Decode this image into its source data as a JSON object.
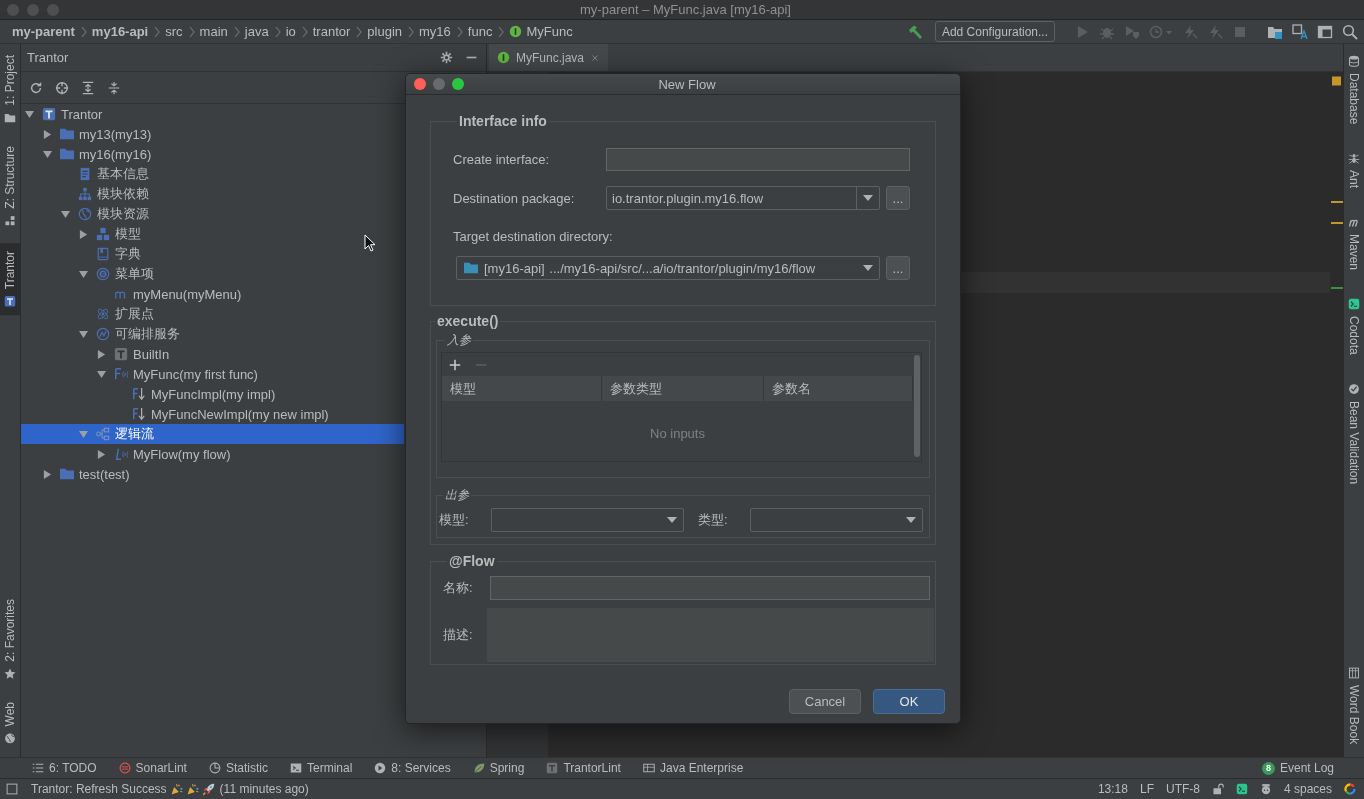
{
  "window": {
    "title": "my-parent – MyFunc.java [my16-api]"
  },
  "breadcrumbs": [
    {
      "label": "my-parent",
      "kind": "module"
    },
    {
      "label": "my16-api",
      "kind": "module"
    },
    {
      "label": "src",
      "kind": "folder"
    },
    {
      "label": "main",
      "kind": "folder"
    },
    {
      "label": "java",
      "kind": "folder"
    },
    {
      "label": "io",
      "kind": "folder"
    },
    {
      "label": "trantor",
      "kind": "folder"
    },
    {
      "label": "plugin",
      "kind": "folder"
    },
    {
      "label": "my16",
      "kind": "folder"
    },
    {
      "label": "func",
      "kind": "folder"
    },
    {
      "label": "MyFunc",
      "kind": "interface"
    }
  ],
  "toolbar": [
    {
      "kind": "build",
      "disabled": false
    },
    {
      "kind": "configuration",
      "label": "Add Configuration..."
    },
    {
      "kind": "run",
      "disabled": true
    },
    {
      "kind": "debug",
      "disabled": true
    },
    {
      "kind": "coverage",
      "disabled": true
    },
    {
      "kind": "profile",
      "disabled": true
    },
    {
      "kind": "reload",
      "disabled": true
    },
    {
      "kind": "reload",
      "disabled": true
    },
    {
      "kind": "stop",
      "disabled": true
    },
    {
      "kind": "structure",
      "disabled": false
    },
    {
      "kind": "translate",
      "disabled": false
    },
    {
      "kind": "layout",
      "disabled": false
    },
    {
      "kind": "search",
      "disabled": false
    }
  ],
  "left_stripe": {
    "top": [
      {
        "label": "1: Project",
        "kind": "project",
        "selected": false
      },
      {
        "label": "Z: Structure",
        "kind": "structure",
        "selected": false
      },
      {
        "label": "Trantor",
        "kind": "trantor",
        "selected": true
      }
    ],
    "bottom": [
      {
        "label": "2: Favorites",
        "kind": "favorites",
        "selected": false
      },
      {
        "label": "Web",
        "kind": "web",
        "selected": false
      }
    ]
  },
  "tool_window": {
    "title": "Trantor",
    "tree": [
      {
        "label": "Trantor",
        "kind": "root",
        "expanded": true,
        "selected": false,
        "children": [
          {
            "label": "my13(my13)",
            "kind": "module",
            "expanded": false,
            "selected": false
          },
          {
            "label": "my16(my16)",
            "kind": "module",
            "expanded": true,
            "selected": false,
            "children": [
              {
                "label": "基本信息",
                "kind": "info",
                "selected": false
              },
              {
                "label": "模块依赖",
                "kind": "dependency",
                "selected": false
              },
              {
                "label": "模块资源",
                "kind": "resources",
                "expanded": true,
                "selected": false,
                "children": [
                  {
                    "label": "模型",
                    "kind": "model",
                    "expanded": false,
                    "selected": false
                  },
                  {
                    "label": "字典",
                    "kind": "dictionary",
                    "selected": false
                  },
                  {
                    "label": "菜单项",
                    "kind": "menu",
                    "expanded": true,
                    "selected": false,
                    "children": [
                      {
                        "label": "myMenu(myMenu)",
                        "kind": "menu-item",
                        "selected": false
                      }
                    ]
                  },
                  {
                    "label": "扩展点",
                    "kind": "extension",
                    "selected": false
                  },
                  {
                    "label": "可编排服务",
                    "kind": "service",
                    "expanded": true,
                    "selected": false,
                    "children": [
                      {
                        "label": "BuiltIn",
                        "kind": "builtin",
                        "expanded": false,
                        "selected": false
                      },
                      {
                        "label": "MyFunc(my first func)",
                        "kind": "function",
                        "expanded": true,
                        "selected": false,
                        "children": [
                          {
                            "label": "MyFuncImpl(my impl)",
                            "kind": "implementation",
                            "selected": false
                          },
                          {
                            "label": "MyFuncNewImpl(my new impl)",
                            "kind": "implementation",
                            "selected": false
                          }
                        ]
                      }
                    ]
                  },
                  {
                    "label": "逻辑流",
                    "kind": "flow-group",
                    "expanded": true,
                    "selected": true,
                    "children": [
                      {
                        "label": "MyFlow(my flow)",
                        "kind": "flow",
                        "expanded": false,
                        "selected": false
                      }
                    ]
                  }
                ]
              }
            ]
          },
          {
            "label": "test(test)",
            "kind": "module",
            "expanded": false,
            "selected": false
          }
        ]
      }
    ]
  },
  "editor": {
    "tabs": [
      {
        "label": "MyFunc.java"
      }
    ]
  },
  "right_stripe": {
    "top": [
      {
        "label": "Database",
        "kind": "database"
      },
      {
        "label": "Ant",
        "kind": "ant"
      },
      {
        "label": "Maven",
        "kind": "maven"
      },
      {
        "label": "Codota",
        "kind": "codota"
      },
      {
        "label": "Bean Validation",
        "kind": "bean"
      }
    ],
    "bottom": [
      {
        "label": "Word Book",
        "kind": "book"
      }
    ]
  },
  "dialog": {
    "title": "New Flow",
    "interface_info": {
      "title": "Interface info",
      "create_interface": {
        "label": "Create interface:"
      },
      "destination_package": {
        "label": "Destination package:",
        "value": "io.trantor.plugin.my16.flow",
        "browse": "..."
      },
      "target_directory": {
        "label": "Target destination directory:",
        "module": "[my16-api]",
        "path": ".../my16-api/src/...a/io/trantor/plugin/my16/flow",
        "browse": "..."
      }
    },
    "execute": {
      "title": "execute()",
      "inputs": {
        "title": "入参",
        "actions": [
          {
            "kind": "add",
            "disabled": false
          },
          {
            "kind": "remove",
            "disabled": true
          }
        ],
        "columns": [
          "模型",
          "参数类型",
          "参数名"
        ],
        "empty_text": "No inputs"
      },
      "outputs": {
        "title": "出参",
        "model_label": "模型:",
        "type_label": "类型:"
      }
    },
    "flow": {
      "title": "@Flow",
      "name_label": "名称:",
      "description_label": "描述:"
    },
    "buttons": [
      {
        "label": "Cancel",
        "default": false
      },
      {
        "label": "OK",
        "default": true
      }
    ]
  },
  "bottom_tools": [
    {
      "label": "6: TODO",
      "kind": "todo"
    },
    {
      "label": "SonarLint",
      "kind": "sonarlint"
    },
    {
      "label": "Statistic",
      "kind": "statistic"
    },
    {
      "label": "Terminal",
      "kind": "terminal"
    },
    {
      "label": "8: Services",
      "kind": "services"
    },
    {
      "label": "Spring",
      "kind": "spring"
    },
    {
      "label": "TrantorLint",
      "kind": "trantorlint"
    },
    {
      "label": "Java Enterprise",
      "kind": "javaee"
    }
  ],
  "event_log": {
    "label": "Event Log",
    "count": "8"
  },
  "status_bar": {
    "message": "Trantor: Refresh Success",
    "time": "(11 minutes ago)",
    "caret_position": "13:18",
    "line_separator": "LF",
    "encoding": "UTF-8",
    "indent": "4 spaces"
  }
}
